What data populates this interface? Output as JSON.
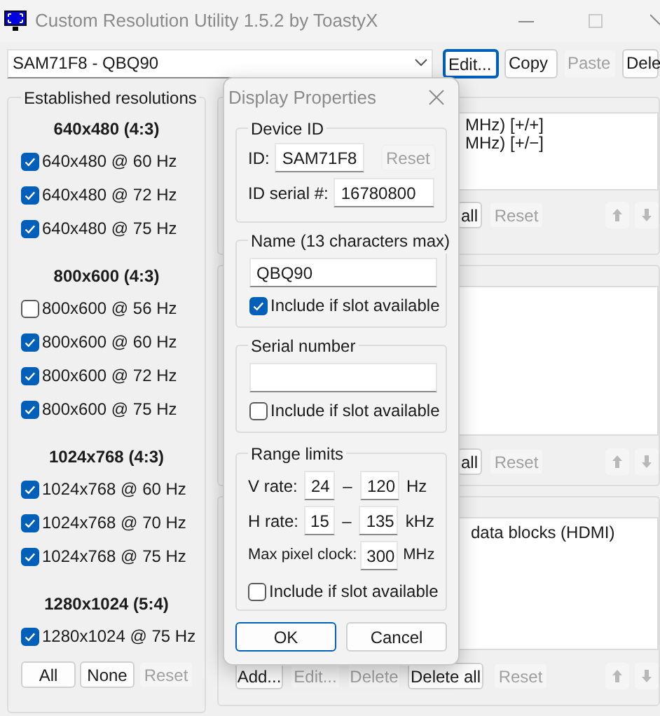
{
  "window": {
    "title": "Custom Resolution Utility 1.5.2 by ToastyX"
  },
  "toolbar": {
    "display_select": "SAM71F8 - QBQ90",
    "buttons": [
      {
        "label": "Edit...",
        "disabled": false,
        "focused": true
      },
      {
        "label": "Copy",
        "disabled": false,
        "focused": false
      },
      {
        "label": "Paste",
        "disabled": true,
        "focused": false
      },
      {
        "label": "Dele",
        "disabled": false,
        "focused": false
      }
    ]
  },
  "established": {
    "title": "Established resolutions",
    "groups": [
      {
        "heading": "640x480 (4:3)",
        "items": [
          {
            "label": "640x480 @ 60 Hz",
            "checked": true
          },
          {
            "label": "640x480 @ 72 Hz",
            "checked": true
          },
          {
            "label": "640x480 @ 75 Hz",
            "checked": true
          }
        ]
      },
      {
        "heading": "800x600 (4:3)",
        "items": [
          {
            "label": "800x600 @ 56 Hz",
            "checked": false
          },
          {
            "label": "800x600 @ 60 Hz",
            "checked": true
          },
          {
            "label": "800x600 @ 72 Hz",
            "checked": true
          },
          {
            "label": "800x600 @ 75 Hz",
            "checked": true
          }
        ]
      },
      {
        "heading": "1024x768 (4:3)",
        "items": [
          {
            "label": "1024x768 @ 60 Hz",
            "checked": true
          },
          {
            "label": "1024x768 @ 70 Hz",
            "checked": true
          },
          {
            "label": "1024x768 @ 75 Hz",
            "checked": true
          }
        ]
      },
      {
        "heading": "1280x1024 (5:4)",
        "items": [
          {
            "label": "1280x1024 @ 75 Hz",
            "checked": true
          }
        ]
      }
    ],
    "buttons": [
      {
        "label": "All",
        "disabled": false
      },
      {
        "label": "None",
        "disabled": false
      },
      {
        "label": "Reset",
        "disabled": true
      }
    ]
  },
  "panels": [
    {
      "lines": [
        "MHz) [+/+]",
        "MHz) [+/−]"
      ],
      "buttons": [
        {
          "label": "all",
          "disabled": false
        },
        {
          "label": "Reset",
          "disabled": true
        }
      ]
    },
    {
      "buttons": [
        {
          "label": "all",
          "disabled": false
        },
        {
          "label": "Reset",
          "disabled": true
        }
      ]
    },
    {
      "lines": [
        "data blocks (HDMI)"
      ],
      "buttons": [
        {
          "label": "Add...",
          "disabled": false
        },
        {
          "label": "Edit...",
          "disabled": true
        },
        {
          "label": "Delete",
          "disabled": true
        },
        {
          "label": "Delete all",
          "disabled": false
        },
        {
          "label": "Reset",
          "disabled": true
        }
      ]
    }
  ],
  "dialog": {
    "title": "Display Properties",
    "device_id": {
      "title": "Device ID",
      "id_label": "ID:",
      "id_value": "SAM71F8",
      "reset": {
        "label": "Reset",
        "disabled": true
      },
      "serial_label": "ID serial #:",
      "serial_value": "16780800"
    },
    "name": {
      "title": "Name (13 characters max)",
      "value": "QBQ90",
      "include": {
        "label": "Include if slot available",
        "checked": true
      }
    },
    "serial_number": {
      "title": "Serial number",
      "include": {
        "label": "Include if slot available",
        "checked": false
      }
    },
    "range_limits": {
      "title": "Range limits",
      "rows": [
        {
          "label": "V rate:",
          "min": "24",
          "dash": "–",
          "max": "120",
          "unit": "Hz"
        },
        {
          "label": "H rate:",
          "min": "15",
          "dash": "–",
          "max": "135",
          "unit": "kHz"
        }
      ],
      "pixel_clock": {
        "label": "Max pixel clock:",
        "value": "300",
        "unit": "MHz"
      },
      "include": {
        "label": "Include if slot available",
        "checked": false
      }
    },
    "buttons": [
      {
        "label": "OK",
        "default": true
      },
      {
        "label": "Cancel",
        "default": false
      }
    ]
  }
}
